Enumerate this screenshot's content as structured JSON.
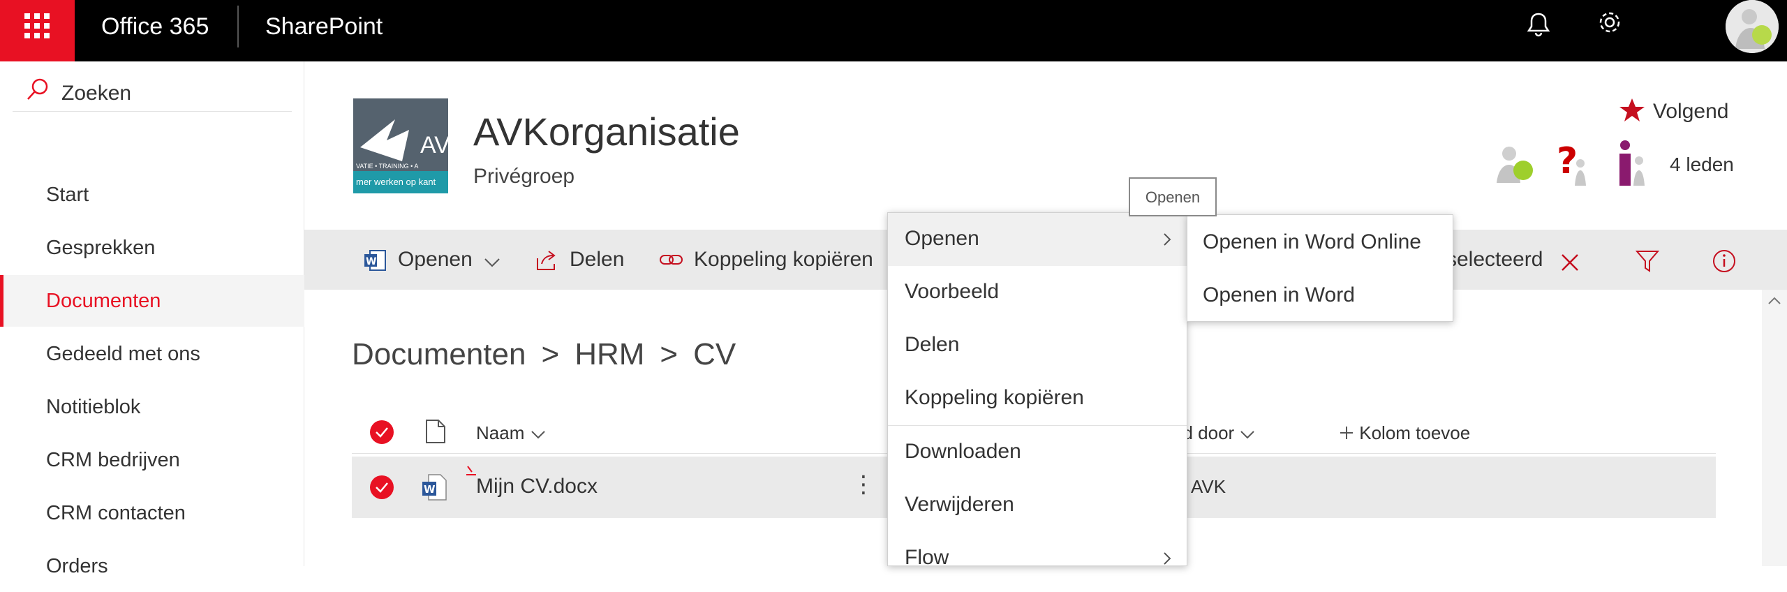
{
  "topbar": {
    "app_title": "Office 365",
    "suite_name": "SharePoint",
    "help_glyph": "?",
    "icons": [
      "waffle-icon",
      "bell-icon",
      "gear-icon",
      "help-icon"
    ],
    "accent_color": "#e81123"
  },
  "nav": {
    "search_label": "Zoeken",
    "items": [
      {
        "label": "Start"
      },
      {
        "label": "Gesprekken"
      },
      {
        "label": "Documenten",
        "active": true
      },
      {
        "label": "Gedeeld met ons"
      },
      {
        "label": "Notitieblok"
      },
      {
        "label": "CRM bedrijven"
      },
      {
        "label": "CRM contacten"
      },
      {
        "label": "Orders"
      }
    ]
  },
  "site": {
    "title": "AVKorganisatie",
    "subtitle": "Privégroep",
    "logo_text": "AV",
    "logo_tagline": "mer werken op kant",
    "logo_strip": "VATIE • TRAINING • A",
    "follow_label": "Volgend",
    "members_label": "4 leden"
  },
  "commandbar": {
    "open_label": "Openen",
    "share_label": "Delen",
    "copy_link_label": "Koppeling kopiëren",
    "selected_label": "selecteerd"
  },
  "breadcrumb": {
    "items": [
      "Documenten",
      "HRM",
      "CV"
    ],
    "separator": ">"
  },
  "list": {
    "columns": {
      "name": "Naam",
      "modified_by": "gd door",
      "add_column": "Kolom toevoe"
    },
    "rows": [
      {
        "name": "Mijn CV.docx",
        "modified_by": "AVK",
        "selected": true
      }
    ],
    "more_glyph": "⋮"
  },
  "context_menu": {
    "items": [
      {
        "label": "Openen",
        "submenu": true
      },
      {
        "label": "Voorbeeld"
      },
      {
        "label": "Delen"
      },
      {
        "label": "Koppeling kopiëren"
      },
      {
        "label": "Downloaden"
      },
      {
        "label": "Verwijderen"
      },
      {
        "label": "Flow",
        "submenu": true
      }
    ],
    "submenu_items": [
      {
        "label": "Openen in Word Online"
      },
      {
        "label": "Openen in Word"
      }
    ],
    "tooltip": "Openen"
  }
}
